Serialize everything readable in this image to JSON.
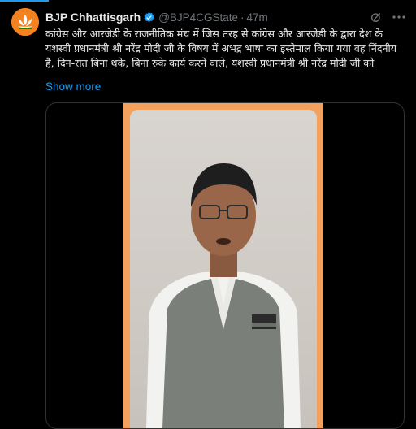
{
  "tweet": {
    "author_name": "BJP Chhattisgarh",
    "handle": "@BJP4CGState",
    "separator": "·",
    "time": "47m",
    "text": "कांग्रेस और आरजेडी के राजनीतिक मंच में जिस तरह से कांग्रेस और आरजेडी के द्वारा देश के यशस्वी प्रधानमंत्री श्री नरेंद्र मोदी जी के विषय में अभद्र भाषा का इस्तेमाल किया गया वह निंदनीय है, दिन-रात बिना थके, बिना रुके कार्य करने वाले, यशस्वी प्रधानमंत्री श्री नरेंद्र मोदी जी को",
    "show_more": "Show more"
  },
  "icons": {
    "verified": "verified-badge-icon",
    "grok": "grok-icon",
    "more": "more-options-icon"
  },
  "colors": {
    "background": "#000000",
    "text": "#e7e9ea",
    "secondary": "#71767b",
    "link": "#1d9bf0",
    "avatar": "#f58220",
    "video_border": "#f4a15d"
  }
}
